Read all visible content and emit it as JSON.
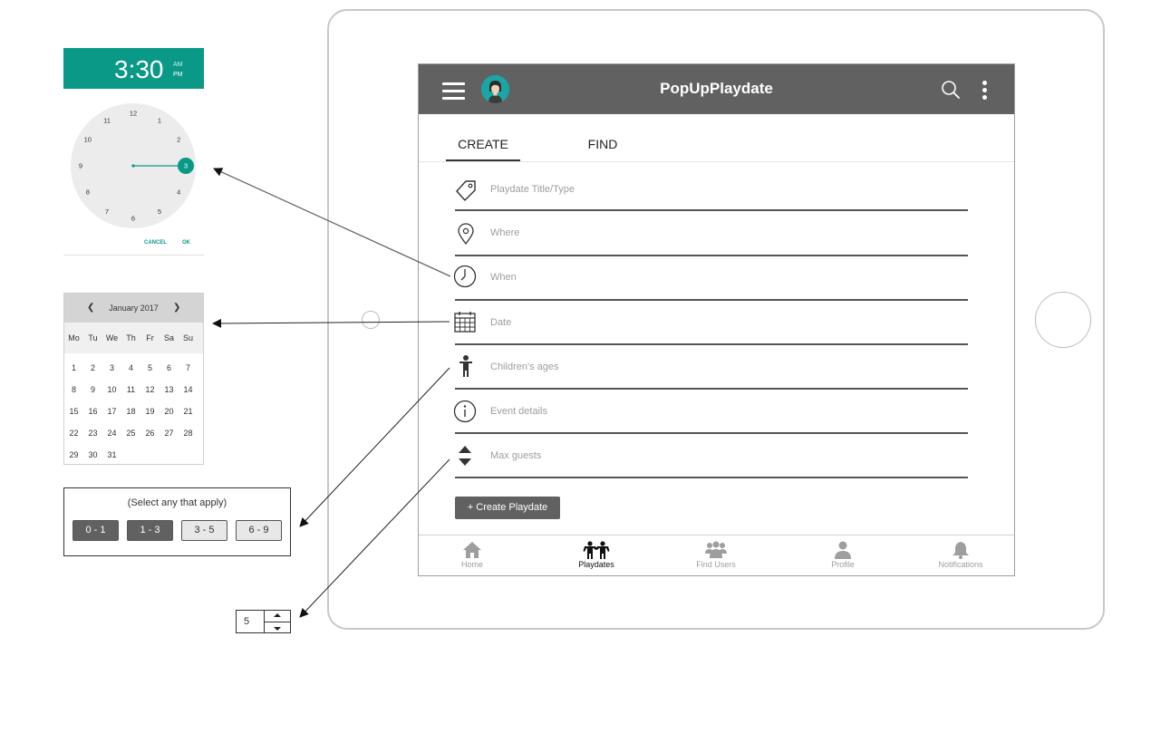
{
  "app": {
    "title": "PopUpPlaydate"
  },
  "tabs": [
    {
      "label": "CREATE"
    },
    {
      "label": "FIND"
    }
  ],
  "form": {
    "fields": [
      {
        "icon": "tag-icon",
        "placeholder": "Playdate Title/Type"
      },
      {
        "icon": "location-pin-icon",
        "placeholder": "Where"
      },
      {
        "icon": "clock-icon",
        "placeholder": "When"
      },
      {
        "icon": "calendar-icon",
        "placeholder": "Date"
      },
      {
        "icon": "child-icon",
        "placeholder": "Children's ages"
      },
      {
        "icon": "info-icon",
        "placeholder": "Event details"
      },
      {
        "icon": "sort-arrows-icon",
        "placeholder": "Max guests"
      }
    ],
    "create_button": "+  Create Playdate"
  },
  "bottom_nav": [
    {
      "label": "Home",
      "icon": "home-icon",
      "active": false
    },
    {
      "label": "Playdates",
      "icon": "kids-icon",
      "active": true
    },
    {
      "label": "Find Users",
      "icon": "users-icon",
      "active": false
    },
    {
      "label": "Profile",
      "icon": "person-icon",
      "active": false
    },
    {
      "label": "Notifications",
      "icon": "bell-icon",
      "active": false
    }
  ],
  "time_picker": {
    "time": "3:30",
    "am": "AM",
    "pm": "PM",
    "dial": [
      "12",
      "1",
      "2",
      "3",
      "4",
      "5",
      "6",
      "7",
      "8",
      "9",
      "10",
      "11"
    ],
    "selected_hour": "3",
    "cancel": "CANCEL",
    "ok": "OK",
    "accent": "#0a9987"
  },
  "calendar": {
    "prev": "❮",
    "next": "❯",
    "month": "January 2017",
    "days_of_week": [
      "Mo",
      "Tu",
      "We",
      "Th",
      "Fr",
      "Sa",
      "Su"
    ],
    "weeks": [
      [
        "1",
        "2",
        "3",
        "4",
        "5",
        "6",
        "7"
      ],
      [
        "8",
        "9",
        "10",
        "11",
        "12",
        "13",
        "14"
      ],
      [
        "15",
        "16",
        "17",
        "18",
        "19",
        "20",
        "21"
      ],
      [
        "22",
        "23",
        "24",
        "25",
        "26",
        "27",
        "28"
      ],
      [
        "29",
        "30",
        "31"
      ]
    ]
  },
  "ages": {
    "hint": "(Select any that apply)",
    "options": [
      {
        "label": "0 - 1",
        "selected": true
      },
      {
        "label": "1 - 3",
        "selected": true
      },
      {
        "label": "3 - 5",
        "selected": false
      },
      {
        "label": "6 - 9",
        "selected": false
      }
    ]
  },
  "stepper": {
    "value": "5"
  },
  "colors": {
    "appbar": "#616161",
    "accent": "#0a9987"
  }
}
